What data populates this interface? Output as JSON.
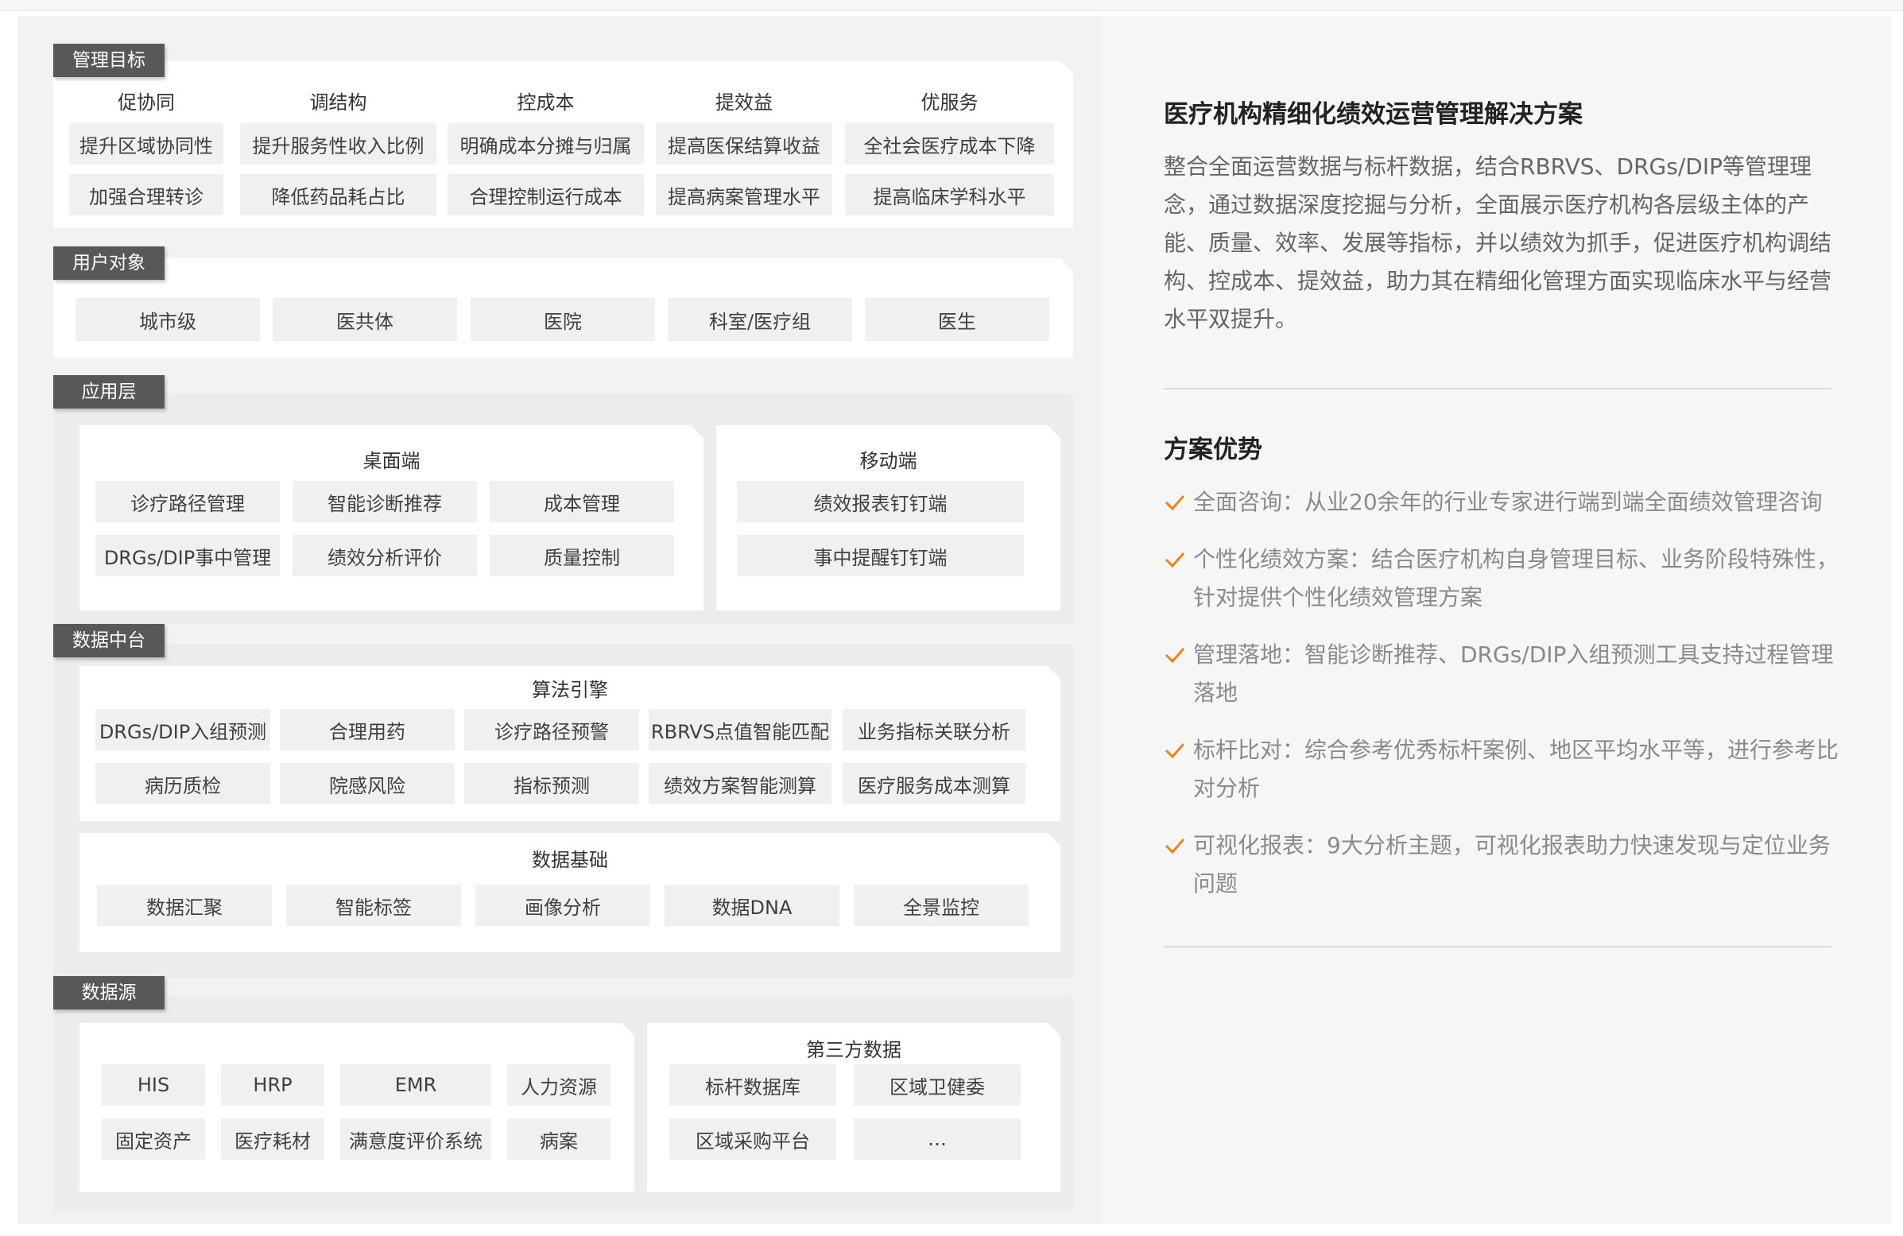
{
  "diagram": {
    "management_goals": {
      "label": "管理目标",
      "columns": [
        {
          "head": "促协同",
          "items": [
            "提升区域协同性",
            "加强合理转诊"
          ]
        },
        {
          "head": "调结构",
          "items": [
            "提升服务性收入比例",
            "降低药品耗占比"
          ]
        },
        {
          "head": "控成本",
          "items": [
            "明确成本分摊与归属",
            "合理控制运行成本"
          ]
        },
        {
          "head": "提效益",
          "items": [
            "提高医保结算收益",
            "提高病案管理水平"
          ]
        },
        {
          "head": "优服务",
          "items": [
            "全社会医疗成本下降",
            "提高临床学科水平"
          ]
        }
      ]
    },
    "user_objects": {
      "label": "用户对象",
      "items": [
        "城市级",
        "医共体",
        "医院",
        "科室/医疗组",
        "医生"
      ]
    },
    "app_layer": {
      "label": "应用层",
      "desktop": {
        "title": "桌面端",
        "items": [
          "诊疗路径管理",
          "智能诊断推荐",
          "成本管理",
          "DRGs/DIP事中管理",
          "绩效分析评价",
          "质量控制"
        ]
      },
      "mobile": {
        "title": "移动端",
        "items": [
          "绩效报表钉钉端",
          "事中提醒钉钉端"
        ]
      }
    },
    "data_platform": {
      "label": "数据中台",
      "algorithm": {
        "title": "算法引擎",
        "items": [
          "DRGs/DIP入组预测",
          "合理用药",
          "诊疗路径预警",
          "RBRVS点值智能匹配",
          "业务指标关联分析",
          "病历质检",
          "院感风险",
          "指标预测",
          "绩效方案智能测算",
          "医疗服务成本测算"
        ]
      },
      "foundation": {
        "title": "数据基础",
        "items": [
          "数据汇聚",
          "智能标签",
          "画像分析",
          "数据DNA",
          "全景监控"
        ]
      }
    },
    "data_source": {
      "label": "数据源",
      "internal": {
        "items": [
          "HIS",
          "HRP",
          "EMR",
          "人力资源",
          "固定资产",
          "医疗耗材",
          "满意度评价系统",
          "病案"
        ]
      },
      "third_party": {
        "title": "第三方数据",
        "items": [
          "标杆数据库",
          "区域卫健委",
          "区域采购平台",
          "…"
        ]
      }
    }
  },
  "side": {
    "title": "医疗机构精细化绩效运营管理解决方案",
    "description": "整合全面运营数据与标杆数据，结合RBRVS、DRGs/DIP等管理理念，通过数据深度挖掘与分析，全面展示医疗机构各层级主体的产能、质量、效率、发展等指标，并以绩效为抓手，促进医疗机构调结构、控成本、提效益，助力其在精细化管理方面实现临床水平与经营水平双提升。",
    "advantages_title": "方案优势",
    "advantages": [
      "全面咨询：从业20余年的行业专家进行端到端全面绩效管理咨询",
      "个性化绩效方案：结合医疗机构自身管理目标、业务阶段特殊性，针对提供个性化绩效管理方案",
      "管理落地：智能诊断推荐、DRGs/DIP入组预测工具支持过程管理落地",
      "标杆比对：综合参考优秀标杆案例、地区平均水平等，进行参考比对分析",
      "可视化报表：9大分析主题，可视化报表助力快速发现与定位业务问题"
    ],
    "check_color": "#f0811e"
  }
}
